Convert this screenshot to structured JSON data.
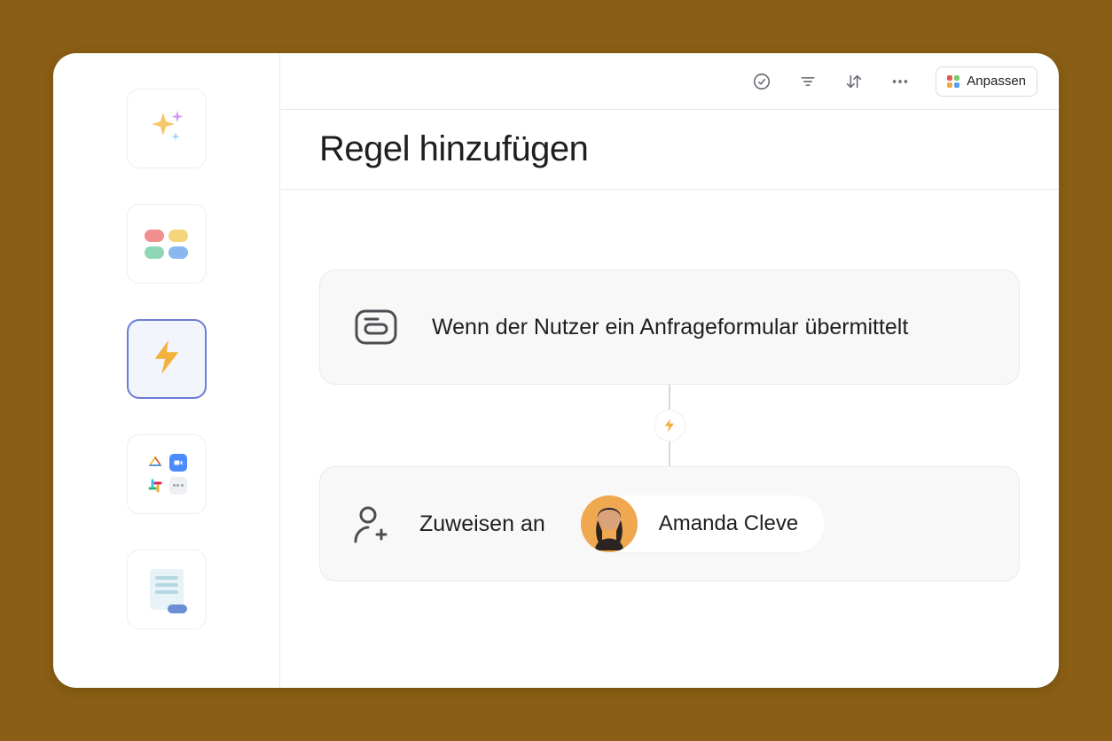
{
  "toolbar": {
    "customize_label": "Anpassen"
  },
  "page": {
    "title": "Regel hinzufügen"
  },
  "trigger": {
    "text": "Wenn der Nutzer ein Anfrageformular übermittelt"
  },
  "action": {
    "label": "Zuweisen an",
    "assignee_name": "Amanda Cleve"
  },
  "sidebar": {
    "items": [
      {
        "name": "ai-sparkle"
      },
      {
        "name": "color-pills"
      },
      {
        "name": "automation-bolt",
        "selected": true
      },
      {
        "name": "integrations-apps"
      },
      {
        "name": "document-template"
      }
    ]
  }
}
